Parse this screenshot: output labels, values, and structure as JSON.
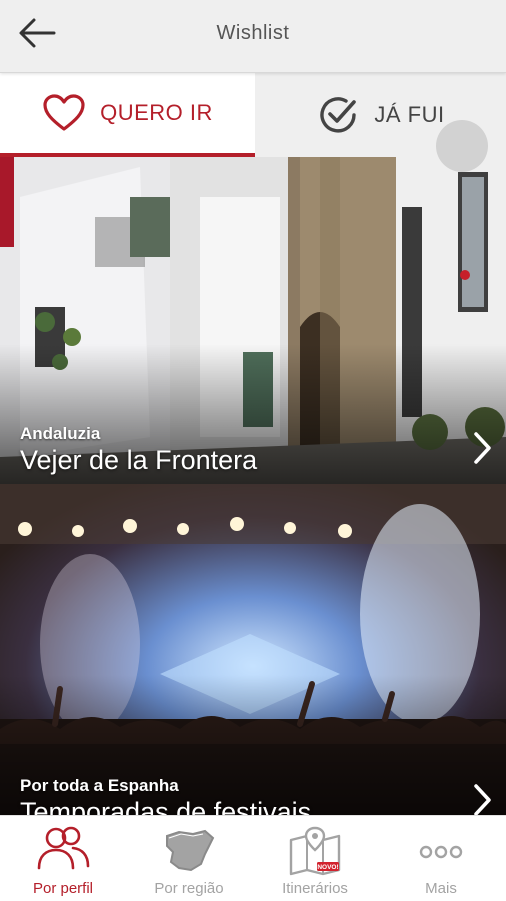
{
  "header": {
    "title": "Wishlist",
    "back_icon": "arrow-left-icon"
  },
  "tabs": [
    {
      "label": "QUERO IR",
      "icon": "heart-icon",
      "active": true
    },
    {
      "label": "JÁ FUI",
      "icon": "check-circle-icon",
      "active": false
    }
  ],
  "cards": [
    {
      "region": "Andaluzia",
      "title": "Vejer de la Frontera"
    },
    {
      "region": "Por toda a Espanha",
      "title": "Temporadas de festivais"
    }
  ],
  "bottom_nav": [
    {
      "label": "Por perfil",
      "icon": "people-icon",
      "active": true
    },
    {
      "label": "Por região",
      "icon": "spain-map-icon",
      "active": false
    },
    {
      "label": "Itinerários",
      "icon": "itinerary-map-icon",
      "active": false,
      "badge": "NOVO!"
    },
    {
      "label": "Mais",
      "icon": "more-dots-icon",
      "active": false
    }
  ],
  "colors": {
    "accent": "#b41f2a",
    "header_bg": "#efefef",
    "nav_inactive": "#a3a3a3"
  }
}
